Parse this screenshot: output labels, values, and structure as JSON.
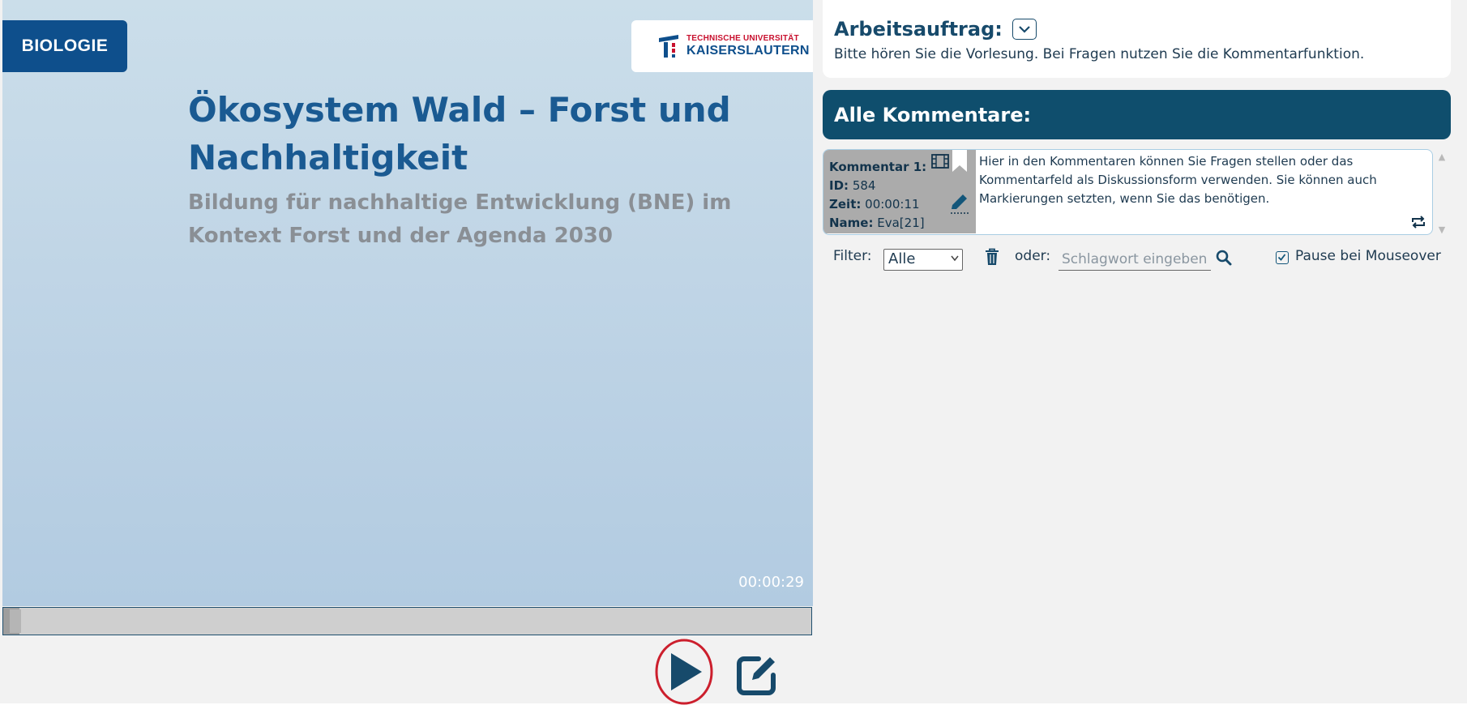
{
  "video": {
    "subject_badge": "BIOLOGIE",
    "university": {
      "line1": "TECHNISCHE UNIVERSITÄT",
      "line2": "KAISERSLAUTERN"
    },
    "slide_title": "Ökosystem Wald – Forst und Nachhaltigkeit",
    "slide_subtitle": "Bildung für nachhaltige Entwicklung (BNE) im Kontext Forst und der Agenda 2030",
    "timestamp": "00:00:29",
    "progress_fraction": 0.02
  },
  "controls": {
    "play": "play-icon",
    "annotate": "edit-icon"
  },
  "task": {
    "heading": "Arbeitsauftrag:",
    "text": "Bitte hören Sie die Vorlesung. Bei Fragen nutzen Sie die Kommentarfunktion."
  },
  "comments": {
    "header": "Alle Kommentare:",
    "items": [
      {
        "title": "Kommentar 1:",
        "id_label": "ID:",
        "id": "584",
        "time_label": "Zeit:",
        "time": "00:00:11",
        "name_label": "Name:",
        "name": "Eva[21]",
        "text": "Hier in den Kommentaren können Sie Fragen stellen oder das Kommentarfeld als Diskussionsform verwenden. Sie können auch Markierungen setzten, wenn Sie das benötigen."
      }
    ]
  },
  "filter": {
    "label": "Filter:",
    "selected": "Alle",
    "or_label": "oder:",
    "search_placeholder": "Schlagwort eingeben",
    "pause_label": "Pause bei Mouseover",
    "pause_checked": true
  },
  "colors": {
    "brand": "#0e4f8c",
    "header": "#0f4e6d",
    "play_highlight": "#cc1f2d"
  }
}
